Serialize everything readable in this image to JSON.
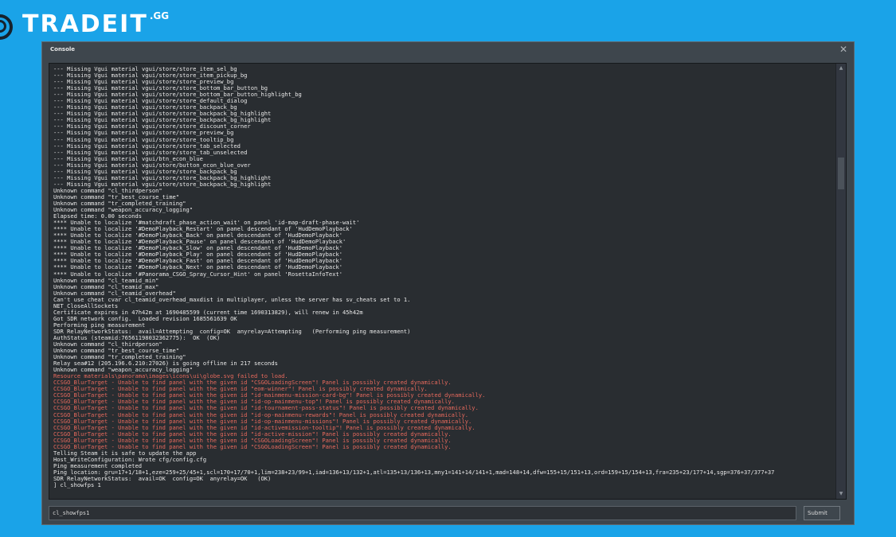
{
  "brand": {
    "name": "TRADEIT",
    "suffix": ".GG"
  },
  "window": {
    "title": "Console",
    "close_icon": "✕"
  },
  "console": {
    "lines": [
      {
        "t": "--- Missing Vgui material vgui/store/store_item_sel_bg"
      },
      {
        "t": "--- Missing Vgui material vgui/store/store_item_pickup_bg"
      },
      {
        "t": "--- Missing Vgui material vgui/store/store_preview_bg"
      },
      {
        "t": "--- Missing Vgui material vgui/store/store_bottom_bar_button_bg"
      },
      {
        "t": "--- Missing Vgui material vgui/store/store_bottom_bar_button_highlight_bg"
      },
      {
        "t": "--- Missing Vgui material vgui/store/store_default_dialog"
      },
      {
        "t": "--- Missing Vgui material vgui/store/store_backpack_bg"
      },
      {
        "t": "--- Missing Vgui material vgui/store/store_backpack_bg_highlight"
      },
      {
        "t": "--- Missing Vgui material vgui/store/store_backpack_bg_highlight"
      },
      {
        "t": "--- Missing Vgui material vgui/store/store_discount_corner"
      },
      {
        "t": "--- Missing Vgui material vgui/store/store_preview_bg"
      },
      {
        "t": "--- Missing Vgui material vgui/store/store_tooltip_bg"
      },
      {
        "t": "--- Missing Vgui material vgui/store/store_tab_selected"
      },
      {
        "t": "--- Missing Vgui material vgui/store/store_tab_unselected"
      },
      {
        "t": "--- Missing Vgui material vgui/btn_econ_blue"
      },
      {
        "t": "--- Missing Vgui material vgui/store/button_econ_blue_over"
      },
      {
        "t": "--- Missing Vgui material vgui/store/store_backpack_bg"
      },
      {
        "t": "--- Missing Vgui material vgui/store/store_backpack_bg_highlight"
      },
      {
        "t": "--- Missing Vgui material vgui/store/store_backpack_bg_highlight"
      },
      {
        "t": "Unknown command \"cl_thirdperson\""
      },
      {
        "t": "Unknown command \"tr_best_course_time\""
      },
      {
        "t": "Unknown command \"tr_completed_training\""
      },
      {
        "t": "Unknown command \"weapon_accuracy_logging\""
      },
      {
        "t": "Elapsed time: 0.00 seconds"
      },
      {
        "t": "**** Unable to localize '#matchdraft_phase_action_wait' on panel 'id-map-draft-phase-wait'"
      },
      {
        "t": "**** Unable to localize '#DemoPlayback_Restart' on panel descendant of 'HudDemoPlayback'"
      },
      {
        "t": "**** Unable to localize '#DemoPlayback_Back' on panel descendant of 'HudDemoPlayback'"
      },
      {
        "t": "**** Unable to localize '#DemoPlayback_Pause' on panel descendant of 'HudDemoPlayback'"
      },
      {
        "t": "**** Unable to localize '#DemoPlayback_Slow' on panel descendant of 'HudDemoPlayback'"
      },
      {
        "t": "**** Unable to localize '#DemoPlayback_Play' on panel descendant of 'HudDemoPlayback'"
      },
      {
        "t": "**** Unable to localize '#DemoPlayback_Fast' on panel descendant of 'HudDemoPlayback'"
      },
      {
        "t": "**** Unable to localize '#DemoPlayback_Next' on panel descendant of 'HudDemoPlayback'"
      },
      {
        "t": "**** Unable to localize '#Panorama_CSGO_Spray_Cursor_Hint' on panel 'RosettaInfoText'"
      },
      {
        "t": "Unknown command \"cl_teamid_min\""
      },
      {
        "t": "Unknown command \"cl_teamid_max\""
      },
      {
        "t": "Unknown command \"cl_teamid_overhead\""
      },
      {
        "t": "Can't use cheat cvar cl_teamid_overhead_maxdist in multiplayer, unless the server has sv_cheats set to 1."
      },
      {
        "t": "NET_CloseAllSockets"
      },
      {
        "t": "Certificate expires in 47h42m at 1690485599 (current time 1690313829), will renew in 45h42m"
      },
      {
        "t": "Got SDR network config.  Loaded revision 1685561639 OK"
      },
      {
        "t": "Performing ping measurement"
      },
      {
        "t": "SDR RelayNetworkStatus:  avail=Attempting  config=OK  anyrelay=Attempting   (Performing ping measurement)"
      },
      {
        "t": "AuthStatus (steamid:76561198032362775):  OK  (OK)"
      },
      {
        "t": "Unknown command \"cl_thirdperson\""
      },
      {
        "t": "Unknown command \"tr_best_course_time\""
      },
      {
        "t": "Unknown command \"tr_completed_training\""
      },
      {
        "t": "Relay sea#12 (205.196.6.210:27026) is going offline in 217 seconds"
      },
      {
        "t": "Unknown command \"weapon_accuracy_logging\""
      },
      {
        "t": "Resource materials\\panorama\\images\\icons\\ui\\globe.svg failed to load.",
        "err": true
      },
      {
        "t": "CCSGO_BlurTarget - Unable to find panel with the given id \"CSGOLoadingScreen\"! Panel is possibly created dynamically.",
        "err": true
      },
      {
        "t": "CCSGO_BlurTarget - Unable to find panel with the given id \"eom-winner\"! Panel is possibly created dynamically.",
        "err": true
      },
      {
        "t": "CCSGO_BlurTarget - Unable to find panel with the given id \"id-mainmenu-mission-card-bg\"! Panel is possibly created dynamically.",
        "err": true
      },
      {
        "t": "CCSGO_BlurTarget - Unable to find panel with the given id \"id-op-mainmenu-top\"! Panel is possibly created dynamically.",
        "err": true
      },
      {
        "t": "CCSGO_BlurTarget - Unable to find panel with the given id \"id-tournament-pass-status\"! Panel is possibly created dynamically.",
        "err": true
      },
      {
        "t": "CCSGO_BlurTarget - Unable to find panel with the given id \"id-op-mainmenu-rewards\"! Panel is possibly created dynamically.",
        "err": true
      },
      {
        "t": "CCSGO_BlurTarget - Unable to find panel with the given id \"id-op-mainmenu-missions\"! Panel is possibly created dynamically.",
        "err": true
      },
      {
        "t": "CCSGO_BlurTarget - Unable to find panel with the given id \"id-activemission-tooltip\"! Panel is possibly created dynamically.",
        "err": true
      },
      {
        "t": "CCSGO_BlurTarget - Unable to find panel with the given id \"id-active-mission\"! Panel is possibly created dynamically.",
        "err": true
      },
      {
        "t": "CCSGO_BlurTarget - Unable to find panel with the given id \"CSGOLoadingScreen\"! Panel is possibly created dynamically.",
        "err": true
      },
      {
        "t": "CCSGO_BlurTarget - Unable to find panel with the given id \"CSGOLoadingScreen\"! Panel is possibly created dynamically.",
        "err": true
      },
      {
        "t": "Telling Steam it is safe to update the app"
      },
      {
        "t": "Host_WriteConfiguration: Wrote cfg/config.cfg"
      },
      {
        "t": "Ping measurement completed"
      },
      {
        "t": "Ping location: gru=17+1/18+1,eze=259+25/45+1,scl=170+17/70+1,lim=238+23/99+1,iad=136+13/132+1,atl=135+13/136+13,mny1=141+14/141+1,mad=148+14,dfw=155+15/151+13,ord=159+15/154+13,fra=235+23/177+14,sgp=376+37/377+37"
      },
      {
        "t": "SDR RelayNetworkStatus:  avail=OK  config=OK  anyrelay=OK   (OK)"
      },
      {
        "t": "] cl_showfps 1"
      }
    ]
  },
  "input": {
    "value": "cl_showfps1"
  },
  "submit_label": "Submit"
}
